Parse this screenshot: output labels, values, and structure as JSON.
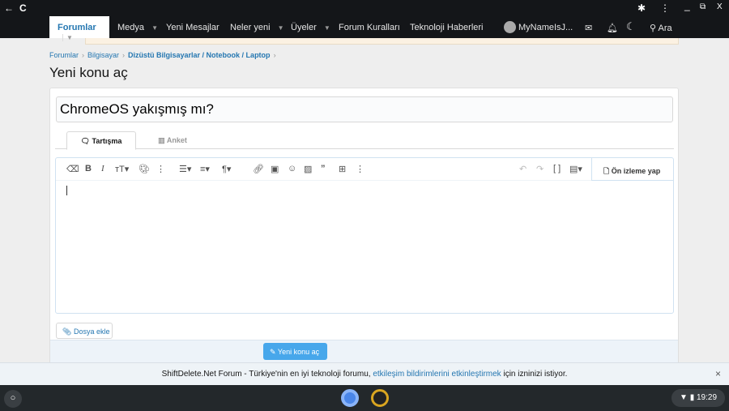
{
  "browser": {
    "back": "←",
    "reload": "C",
    "extensions": "✱",
    "menu": "⋮",
    "minimize": "_",
    "restore": "⧉",
    "close": "X"
  },
  "nav": {
    "items": [
      {
        "label": "Forumlar"
      },
      {
        "label": "Medya"
      },
      {
        "label": "Yeni Mesajlar"
      },
      {
        "label": "Neler yeni"
      },
      {
        "label": "Üyeler"
      },
      {
        "label": "Forum Kuralları"
      },
      {
        "label": "Teknoloji Haberleri"
      }
    ],
    "username": "MyNameIsJ...",
    "search": "Ara"
  },
  "breadcrumb": [
    "Forumlar",
    "Bilgisayar",
    "Dizüstü Bilgisayarlar / Notebook / Laptop"
  ],
  "page_title": "Yeni konu aç",
  "form": {
    "title_value": "ChromeOS yakışmış mı?",
    "tabs": [
      "Tartışma",
      "Anket"
    ],
    "preview": "Ön izleme yap",
    "attach": "Dosya ekle",
    "submit": "Yeni konu aç"
  },
  "push": {
    "text_before": "ShiftDelete.Net Forum - Türkiye'nin en iyi teknoloji forumu, ",
    "link": "etkileşim bildirimlerini etkinleştirmek",
    "text_after": " için izninizi istiyor.",
    "close": "×"
  },
  "shelf": {
    "time": "19:29"
  }
}
